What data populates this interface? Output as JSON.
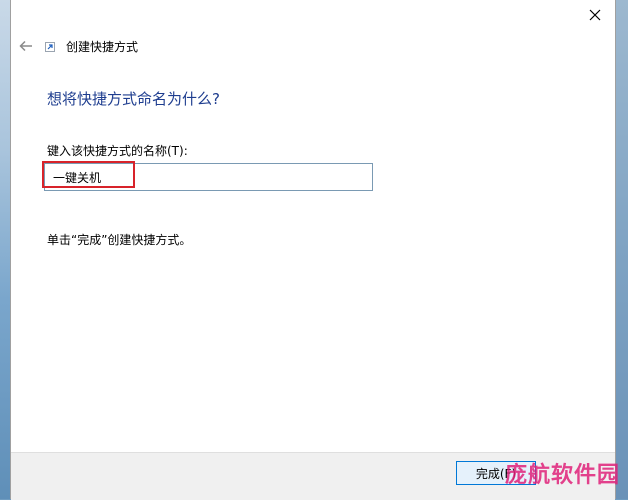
{
  "wizard": {
    "title": "创建快捷方式",
    "heading": "想将快捷方式命名为什么?",
    "field_label": "键入该快捷方式的名称(T):",
    "name_value": "一键关机",
    "instruction": "单击“完成”创建快捷方式。"
  },
  "footer": {
    "finish_label": "完成(F)"
  },
  "watermark": {
    "text": "庞航软件园"
  },
  "icons": {
    "close": "close-icon",
    "back": "back-arrow-icon",
    "shortcut": "shortcut-icon"
  },
  "colors": {
    "heading": "#1e3d8f",
    "highlight": "#d8232a",
    "accent": "#0078d7",
    "watermark": "#e0227a"
  }
}
